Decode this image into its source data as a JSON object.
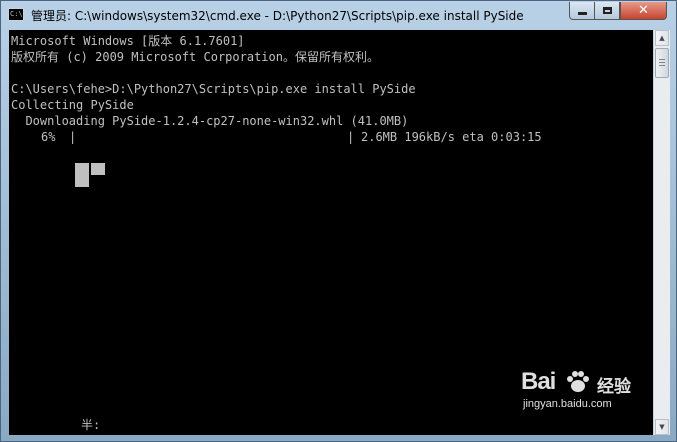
{
  "window": {
    "title": "管理员: C:\\windows\\system32\\cmd.exe - D:\\Python27\\Scripts\\pip.exe  install PySide",
    "icon": "cmd-icon",
    "icon_text": "C:\\"
  },
  "controls": {
    "minimize": "minimize-icon",
    "maximize": "maximize-icon",
    "close_glyph": "✕"
  },
  "console": {
    "lines": [
      "Microsoft Windows [版本 6.1.7601]",
      "版权所有 (c) 2009 Microsoft Corporation。保留所有权利。",
      "C:\\Users\\fehe>D:\\Python27\\Scripts\\pip.exe install PySide",
      "Collecting PySide",
      "  Downloading PySide-1.2.4-cp27-none-win32.whl (41.0MB)"
    ],
    "progress": {
      "percent_label": "6%",
      "percent": 6,
      "bar_left": "|",
      "bar_right": "|",
      "stats": "2.6MB 196kB/s eta 0:03:15"
    },
    "ime_status": "半:"
  },
  "watermark": {
    "logo": "Bai",
    "cn": "经验",
    "url": "jingyan.baidu.com"
  },
  "colors": {
    "console_bg": "#000000",
    "console_text": "#c0c0c0",
    "close_button": "#c5452f"
  }
}
